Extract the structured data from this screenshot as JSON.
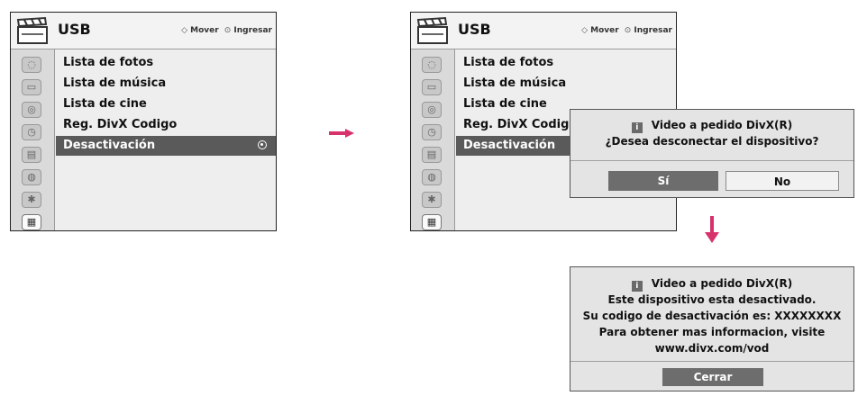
{
  "header": {
    "title": "USB",
    "hint_move": "Mover",
    "hint_enter": "Ingresar"
  },
  "sidebar_icons": [
    "photo-icon",
    "tv-icon",
    "speaker-icon",
    "clock-icon",
    "briefcase-icon",
    "lock-icon",
    "bluetooth-icon",
    "usb-clapper-icon"
  ],
  "menu": {
    "items": [
      "Lista de fotos",
      "Lista de música",
      "Lista de cine",
      "Reg. DivX Codigo",
      "Desactivación"
    ],
    "selected_index": 4
  },
  "confirm_dialog": {
    "title": "Video a pedido DivX(R)",
    "message": "¿Desea desconectar el dispositivo?",
    "yes_label": "Sí",
    "no_label": "No"
  },
  "info_dialog": {
    "title": "Video a pedido DivX(R)",
    "lines": [
      "Este dispositivo esta desactivado.",
      "Su codigo de desactivación es: XXXXXXXX",
      "Para obtener mas informacion, visite",
      "www.divx.com/vod"
    ],
    "close_label": "Cerrar"
  },
  "colors": {
    "arrow": "#d6336c",
    "selected_row": "#5a5a5a",
    "button_dark": "#6d6d6d"
  }
}
